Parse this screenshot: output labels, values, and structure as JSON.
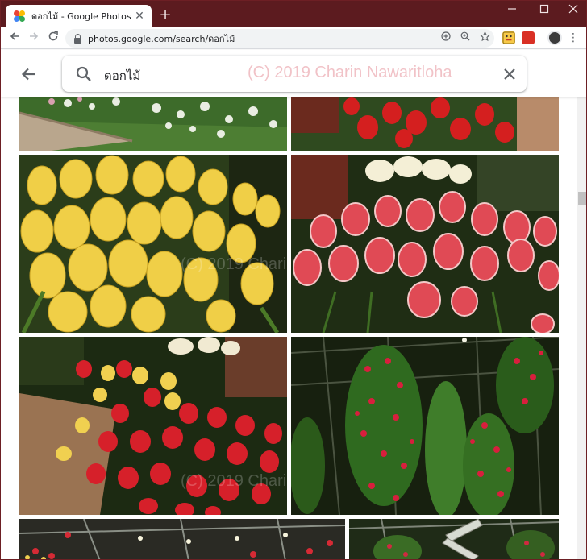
{
  "browser": {
    "tab_title": "ดอกไม้ - Google Photos",
    "tab_close_icon": "close-icon",
    "new_tab_symbol": "+",
    "minimize_symbol": "—",
    "maximize_symbol": "☐",
    "close_symbol": "✕",
    "url": "photos.google.com/search/ดอกไม้",
    "frame_color": "#5c1b1f"
  },
  "toolbar": {
    "back_symbol": "←",
    "forward_symbol": "→",
    "reload_symbol": "↻",
    "menu_symbol": "⋮"
  },
  "photos": {
    "search_query": "ดอกไม้",
    "watermark": "(C) 2019 Charin Nawaritloha",
    "photo_watermark": "(C) 2019 Charin Nawaritloha",
    "images": [
      {
        "name": "photo-garden-bed",
        "desc": "white flowers garden bed"
      },
      {
        "name": "photo-red-tulips-top",
        "desc": "red tulips"
      },
      {
        "name": "photo-yellow-tulips",
        "desc": "yellow tulips"
      },
      {
        "name": "photo-pink-white-tulips",
        "desc": "pink and white tulips"
      },
      {
        "name": "photo-mixed-tulips",
        "desc": "red and yellow tulips"
      },
      {
        "name": "photo-hanging-flowers",
        "desc": "hanging flower columns"
      },
      {
        "name": "photo-greenhouse-left",
        "desc": "greenhouse"
      },
      {
        "name": "photo-greenhouse-right",
        "desc": "greenhouse windmill"
      }
    ]
  }
}
